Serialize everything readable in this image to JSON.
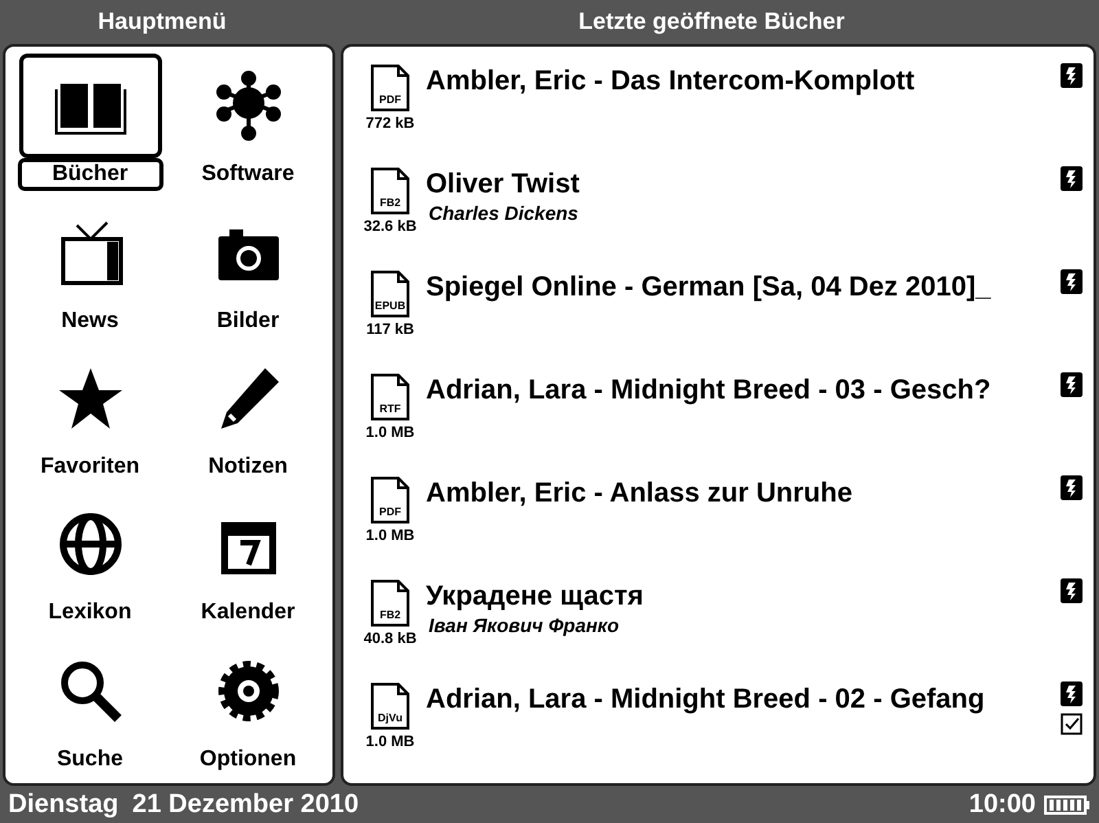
{
  "main_menu": {
    "title": "Hauptmenü",
    "items": [
      {
        "label": "Bücher",
        "selected": true
      },
      {
        "label": "Software",
        "selected": false
      },
      {
        "label": "News",
        "selected": false
      },
      {
        "label": "Bilder",
        "selected": false
      },
      {
        "label": "Favoriten",
        "selected": false
      },
      {
        "label": "Notizen",
        "selected": false
      },
      {
        "label": "Lexikon",
        "selected": false
      },
      {
        "label": "Kalender",
        "selected": false
      },
      {
        "label": "Suche",
        "selected": false
      },
      {
        "label": "Optionen",
        "selected": false
      }
    ]
  },
  "recent_books": {
    "title": "Letzte geöffnete Bücher",
    "items": [
      {
        "title": "Ambler, Eric - Das Intercom-Komplott",
        "format": "PDF",
        "size": "772 kB",
        "checked": false
      },
      {
        "title": "Oliver Twist",
        "author": "Charles Dickens",
        "format": "FB2",
        "size": "32.6 kB",
        "checked": false
      },
      {
        "title": "Spiegel Online - German [Sa, 04 Dez 2010]_",
        "format": "EPUB",
        "size": "117 kB",
        "checked": false
      },
      {
        "title": "Adrian, Lara - Midnight Breed - 03 - Gesch?",
        "format": "RTF",
        "size": "1.0 MB",
        "checked": false
      },
      {
        "title": "Ambler, Eric - Anlass zur Unruhe",
        "format": "PDF",
        "size": "1.0 MB",
        "checked": false
      },
      {
        "title": "Украдене щастя",
        "author": "Іван Якович Франко",
        "format": "FB2",
        "size": "40.8 kB",
        "checked": false
      },
      {
        "title": "Adrian, Lara - Midnight Breed - 02 - Gefang",
        "format": "DjVu",
        "size": "1.0 MB",
        "checked": true
      }
    ]
  },
  "status_bar": {
    "day": "Dienstag",
    "date": "21 Dezember 2010",
    "time": "10:00"
  }
}
